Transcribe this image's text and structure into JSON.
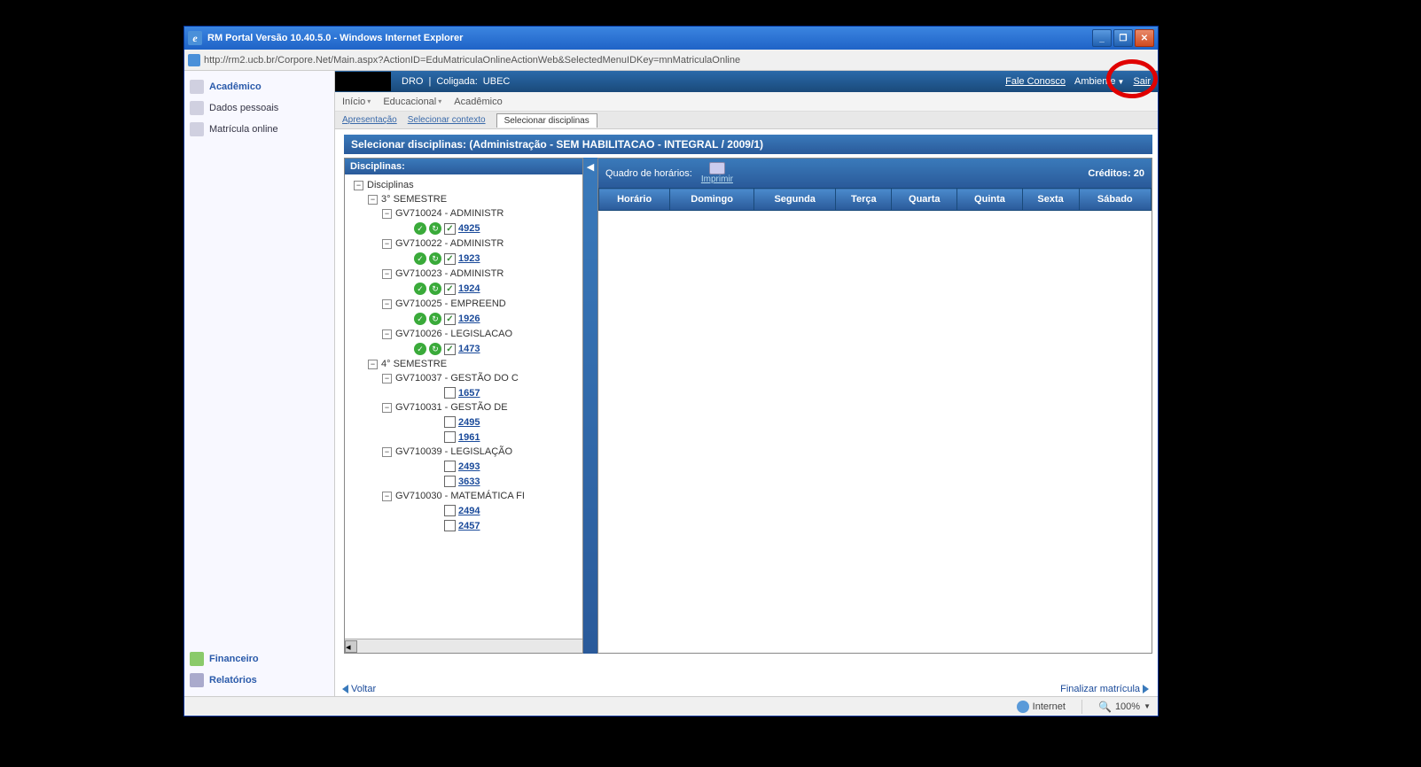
{
  "window": {
    "title": "RM Portal Versão 10.40.5.0 - Windows Internet Explorer",
    "url": "http://rm2.ucb.br/Corpore.Net/Main.aspx?ActionID=EduMatriculaOnlineActionWeb&SelectedMenuIDKey=mnMatriculaOnline"
  },
  "topbar": {
    "pedro_suffix": "DRO",
    "coligada_label": "Coligada:",
    "coligada_value": "UBEC",
    "fale_conosco": "Fale Conosco",
    "ambiente": "Ambiente",
    "sair": "Sair"
  },
  "menubar": {
    "inicio": "Início",
    "educacional": "Educacional",
    "academico": "Acadêmico"
  },
  "submenu": {
    "apresentacao": "Apresentação",
    "selecionar_contexto": "Selecionar contexto",
    "active": "Selecionar disciplinas"
  },
  "sidebar": {
    "academico": "Acadêmico",
    "dados_pessoais": "Dados pessoais",
    "matricula_online": "Matrícula online",
    "financeiro": "Financeiro",
    "relatorios": "Relatórios"
  },
  "section": {
    "title": "Selecionar disciplinas: (Administração - SEM HABILITACAO - INTEGRAL / 2009/1)"
  },
  "disciplinas": {
    "header": "Disciplinas:",
    "root": "Disciplinas",
    "semestre1": "3° SEMESTRE",
    "sem1_items": [
      {
        "code": "GV710024 - ADMINISTR",
        "turma": "4925",
        "checked": true
      },
      {
        "code": "GV710022 - ADMINISTR",
        "turma": "1923",
        "checked": true
      },
      {
        "code": "GV710023 - ADMINISTR",
        "turma": "1924",
        "checked": true
      },
      {
        "code": "GV710025 - EMPREEND",
        "turma": "1926",
        "checked": true
      },
      {
        "code": "GV710026 - LEGISLACAO",
        "turma": "1473",
        "checked": true
      }
    ],
    "semestre2": "4° SEMESTRE",
    "sem2_items": [
      {
        "code": "GV710037 - GESTÃO DO C",
        "turmas": [
          "1657"
        ]
      },
      {
        "code": "GV710031 - GESTÃO DE",
        "turmas": [
          "2495",
          "1961"
        ]
      },
      {
        "code": "GV710039 - LEGISLAÇÃO",
        "turmas": [
          "2493",
          "3633"
        ]
      },
      {
        "code": "GV710030 - MATEMÁTICA FI",
        "turmas": [
          "2494",
          "2457"
        ]
      }
    ]
  },
  "schedule": {
    "label": "Quadro de horários:",
    "imprimir": "Imprimir",
    "credits_label": "Créditos:",
    "credits_value": "20",
    "days": [
      "Horário",
      "Domingo",
      "Segunda",
      "Terça",
      "Quarta",
      "Quinta",
      "Sexta",
      "Sábado"
    ]
  },
  "bottomnav": {
    "voltar": "Voltar",
    "finalizar": "Finalizar matrícula"
  },
  "statusbar": {
    "zone": "Internet",
    "zoom": "100%"
  }
}
